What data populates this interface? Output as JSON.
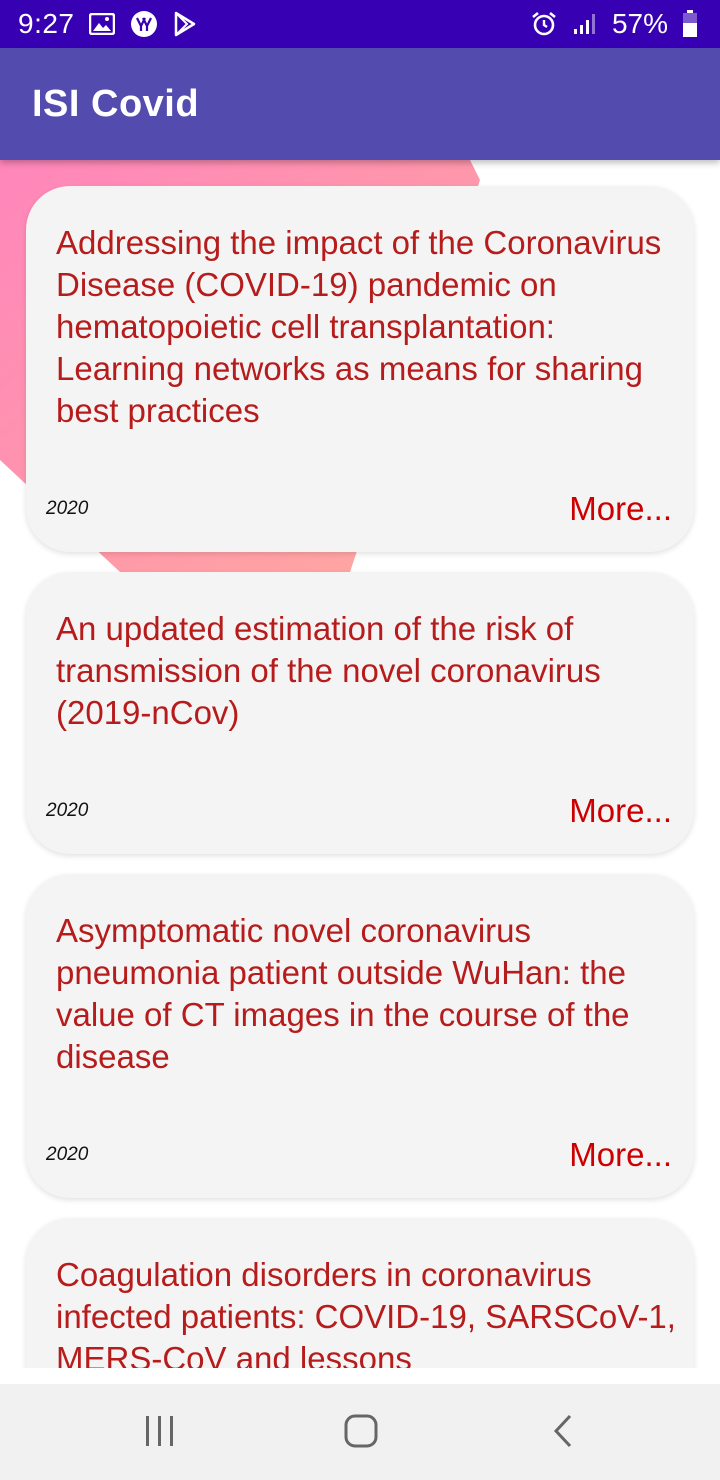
{
  "status_bar": {
    "time": "9:27",
    "battery_percent": "57%",
    "battery_level": 0.57,
    "icons_left": [
      "image-icon",
      "yandex-icon",
      "play-store-icon"
    ],
    "icons_right": [
      "alarm-icon",
      "signal-icon",
      "battery-icon"
    ]
  },
  "app_bar": {
    "title": "ISI Covid",
    "color": "#534bae"
  },
  "articles": [
    {
      "title": "Addressing the impact of the Coronavirus Disease (COVID-19) pandemic on hematopoietic cell transplantation: Learning networks as means for sharing best practices",
      "year": "2020",
      "more": "More..."
    },
    {
      "title": "An updated estimation of the risk of transmission of the novel coronavirus (2019-nCov)",
      "year": "2020",
      "more": "More..."
    },
    {
      "title": "Asymptomatic novel coronavirus pneumonia patient outside WuHan: the value of CT images in the course of the disease",
      "year": "2020",
      "more": "More..."
    },
    {
      "title": "Coagulation disorders in coronavirus infected patients: COVID-19, SARSCoV-1, MERS-CoV and lessons",
      "year": "",
      "more": ""
    }
  ],
  "colors": {
    "status_bar": "#3700b3",
    "title_text": "#b71c1c",
    "more_text": "#cc0000",
    "card_bg": "#f4f4f4"
  },
  "nav_bar": {
    "icons": [
      "recent-apps-icon",
      "home-icon",
      "back-icon"
    ]
  }
}
